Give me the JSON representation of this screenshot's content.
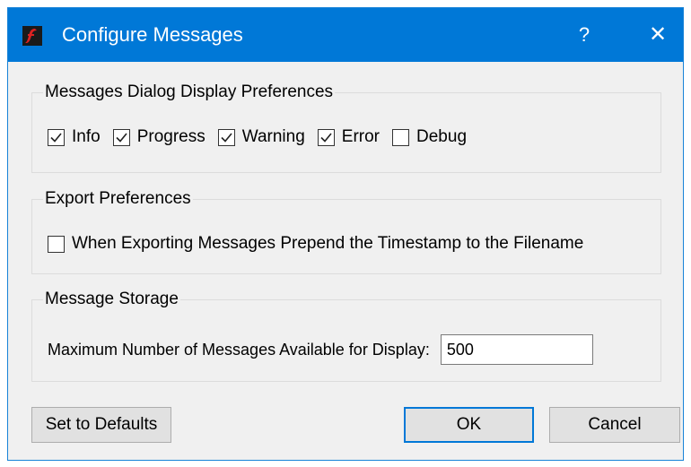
{
  "window": {
    "title": "Configure Messages",
    "help_label": "?",
    "close_label": "✕",
    "icon": "flash-app-icon"
  },
  "display_prefs": {
    "title": "Messages Dialog Display Preferences",
    "options": [
      {
        "label": "Info",
        "checked": true
      },
      {
        "label": "Progress",
        "checked": true
      },
      {
        "label": "Warning",
        "checked": true
      },
      {
        "label": "Error",
        "checked": true
      },
      {
        "label": "Debug",
        "checked": false
      }
    ]
  },
  "export_prefs": {
    "title": "Export Preferences",
    "option": {
      "label": "When Exporting Messages Prepend the Timestamp to the Filename",
      "checked": false
    }
  },
  "storage": {
    "title": "Message Storage",
    "field_label": "Maximum Number of Messages Available for Display:",
    "field_value": "500"
  },
  "buttons": {
    "defaults": "Set to Defaults",
    "ok": "OK",
    "cancel": "Cancel"
  },
  "colors": {
    "titlebar": "#0078d7",
    "dialog_bg": "#f0f0f0"
  }
}
